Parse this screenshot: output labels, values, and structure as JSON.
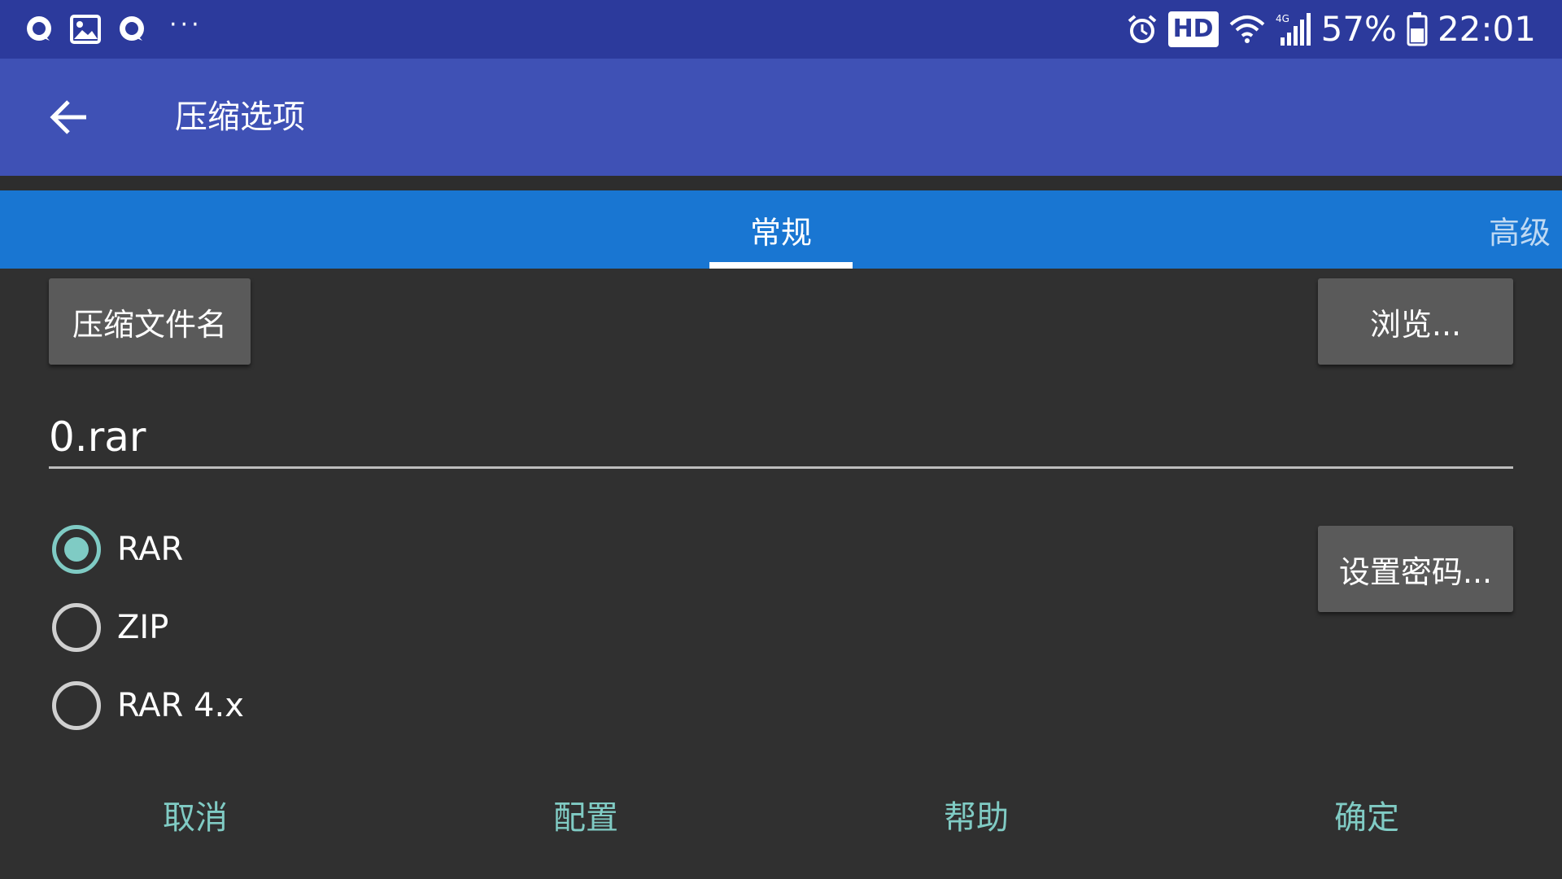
{
  "status_bar": {
    "hd_label": "HD",
    "network_label": "4G",
    "battery": "57%",
    "time": "22:01",
    "dots": "···"
  },
  "app_bar": {
    "title": "压缩选项"
  },
  "tabs": [
    {
      "label": "常规",
      "selected": true
    },
    {
      "label": "高级",
      "selected": false
    }
  ],
  "form": {
    "archive_name_label": "压缩文件名",
    "browse_label": "浏览...",
    "filename_value": "0.rar",
    "set_password_label": "设置密码...",
    "formats": [
      {
        "label": "RAR",
        "checked": true
      },
      {
        "label": "ZIP",
        "checked": false
      },
      {
        "label": "RAR 4.x",
        "checked": false
      }
    ]
  },
  "actions": {
    "cancel": "取消",
    "config": "配置",
    "help": "帮助",
    "ok": "确定"
  },
  "colors": {
    "status_bar": "#2c3a9c",
    "app_bar": "#3f51b5",
    "tab_bar": "#1976d2",
    "background": "#303030",
    "button": "#5a5a5a",
    "accent": "#80cbc4"
  }
}
